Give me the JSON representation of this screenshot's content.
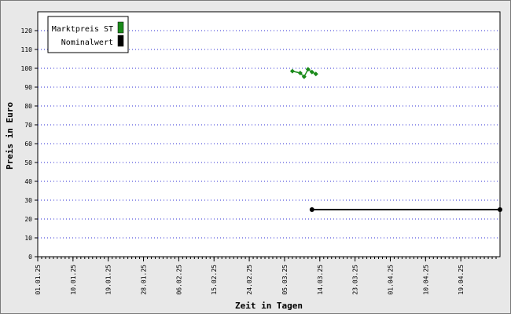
{
  "chart_data": {
    "type": "line",
    "xlabel": "Zeit in Tagen",
    "ylabel": "Preis in Euro",
    "ylim": [
      0,
      130
    ],
    "yticks": [
      0,
      10,
      20,
      30,
      40,
      50,
      60,
      70,
      80,
      90,
      100,
      110,
      120
    ],
    "xlim": [
      "2025-01-01",
      "2025-04-29"
    ],
    "xtick_labels": [
      "01.01.25",
      "10.01.25",
      "19.01.25",
      "28.01.25",
      "06.02.25",
      "15.02.25",
      "24.02.25",
      "05.03.25",
      "14.03.25",
      "23.03.25",
      "01.04.25",
      "10.04.25",
      "19.04.25"
    ],
    "grid": "horizontal dotted",
    "legend_position": "top-left",
    "series": [
      {
        "name": "Marktpreis ST",
        "color": "#1a8a1a",
        "marker": "diamond",
        "points": [
          {
            "x": "2025-03-07",
            "y": 98.5
          },
          {
            "x": "2025-03-09",
            "y": 97.5
          },
          {
            "x": "2025-03-10",
            "y": 95.5
          },
          {
            "x": "2025-03-11",
            "y": 99.5
          },
          {
            "x": "2025-03-12",
            "y": 98.0
          },
          {
            "x": "2025-03-13",
            "y": 97.0
          }
        ]
      },
      {
        "name": "Nominalwert",
        "color": "#000000",
        "marker": "circle",
        "points": [
          {
            "x": "2025-03-12",
            "y": 25
          },
          {
            "x": "2025-04-29",
            "y": 25
          }
        ]
      }
    ]
  }
}
